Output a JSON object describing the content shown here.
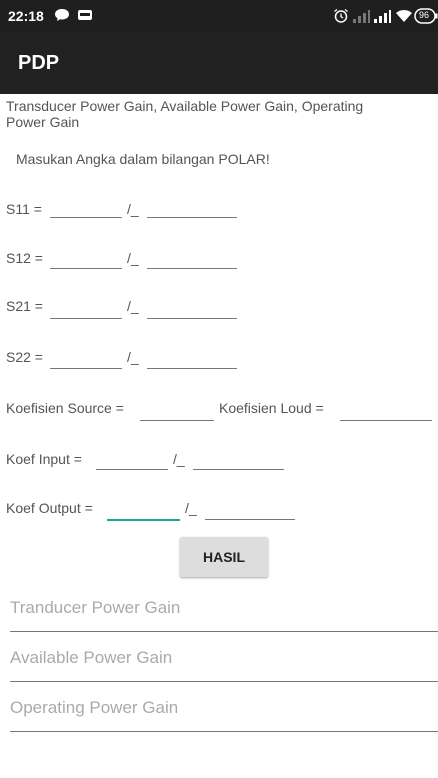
{
  "status_bar": {
    "time": "22:18",
    "battery": "96",
    "icons": [
      "chat-bubble-icon",
      "sim-icon",
      "alarm-icon",
      "signal-icon",
      "signal-icon",
      "wifi-icon",
      "battery-icon"
    ]
  },
  "app_bar": {
    "title": "PDP"
  },
  "content": {
    "header": "Transducer Power Gain, Available Power Gain, Operating Power Gain",
    "instruction": "Masukan Angka dalam bilangan POLAR!",
    "angle_symbol": "/_",
    "rows": [
      {
        "label": "S11 ="
      },
      {
        "label": "S12 ="
      },
      {
        "label": "S21 ="
      },
      {
        "label": "S22 ="
      }
    ],
    "koef_source_label": "Koefisien Source =",
    "koef_load_label": "Koefisien Loud =",
    "koef_input_label": "Koef Input =",
    "koef_output_label": "Koef Output =",
    "button_label": "HASIL",
    "results": {
      "transducer": "Tranducer Power Gain",
      "available": "Available Power Gain",
      "operating": "Operating Power Gain"
    }
  },
  "colors": {
    "accent": "#17a89a",
    "appbar": "#212121",
    "statusbar": "#1f1f1f"
  }
}
